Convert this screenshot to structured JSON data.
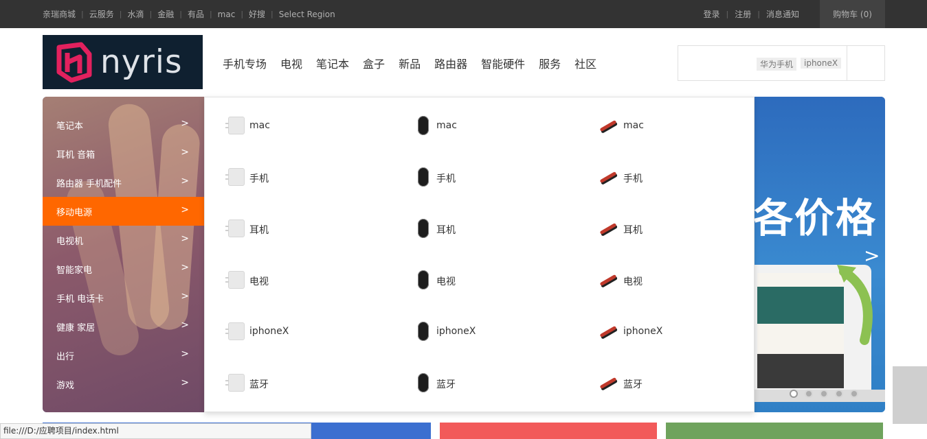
{
  "topbar": {
    "links": [
      "亲瑞商城",
      "云服务",
      "水滴",
      "金融",
      "有品",
      "mac",
      "好搜",
      "Select Region"
    ],
    "login": "登录",
    "register": "注册",
    "messages": "消息通知",
    "cart": "购物车 (0)"
  },
  "logo": {
    "text": "nyris"
  },
  "nav": [
    "手机专场",
    "电视",
    "笔记本",
    "盒子",
    "新品",
    "路由器",
    "智能硬件",
    "服务",
    "社区"
  ],
  "search": {
    "hot_words": [
      "华为手机",
      "iphoneX"
    ]
  },
  "category_menu": [
    {
      "label": "笔记本",
      "arrow": ">"
    },
    {
      "label": "耳机 音箱",
      "arrow": ">"
    },
    {
      "label": "路由器 手机配件",
      "arrow": ">"
    },
    {
      "label": "移动电源",
      "arrow": ">"
    },
    {
      "label": "电视机",
      "arrow": ">"
    },
    {
      "label": "智能家电",
      "arrow": ">"
    },
    {
      "label": "手机 电话卡",
      "arrow": ">"
    },
    {
      "label": "健康 家居",
      "arrow": ">"
    },
    {
      "label": "出行",
      "arrow": ">"
    },
    {
      "label": "游戏",
      "arrow": ">"
    }
  ],
  "flyout": {
    "columns": [
      {
        "icon": "charger-icon",
        "items": [
          "mac",
          "手机",
          "耳机",
          "电视",
          "iphoneX",
          "蓝牙"
        ]
      },
      {
        "icon": "mouse-icon",
        "items": [
          "mac",
          "手机",
          "耳机",
          "电视",
          "iphoneX",
          "蓝牙"
        ]
      },
      {
        "icon": "cable-icon",
        "items": [
          "mac",
          "手机",
          "耳机",
          "电视",
          "iphoneX",
          "蓝牙"
        ]
      }
    ]
  },
  "banner": {
    "headline": "各价格",
    "next": ">"
  },
  "statusbar": {
    "url": "file:///D:/应聘项目/index.html"
  },
  "colors": {
    "accent": "#ff6700",
    "topbar": "#333333"
  }
}
